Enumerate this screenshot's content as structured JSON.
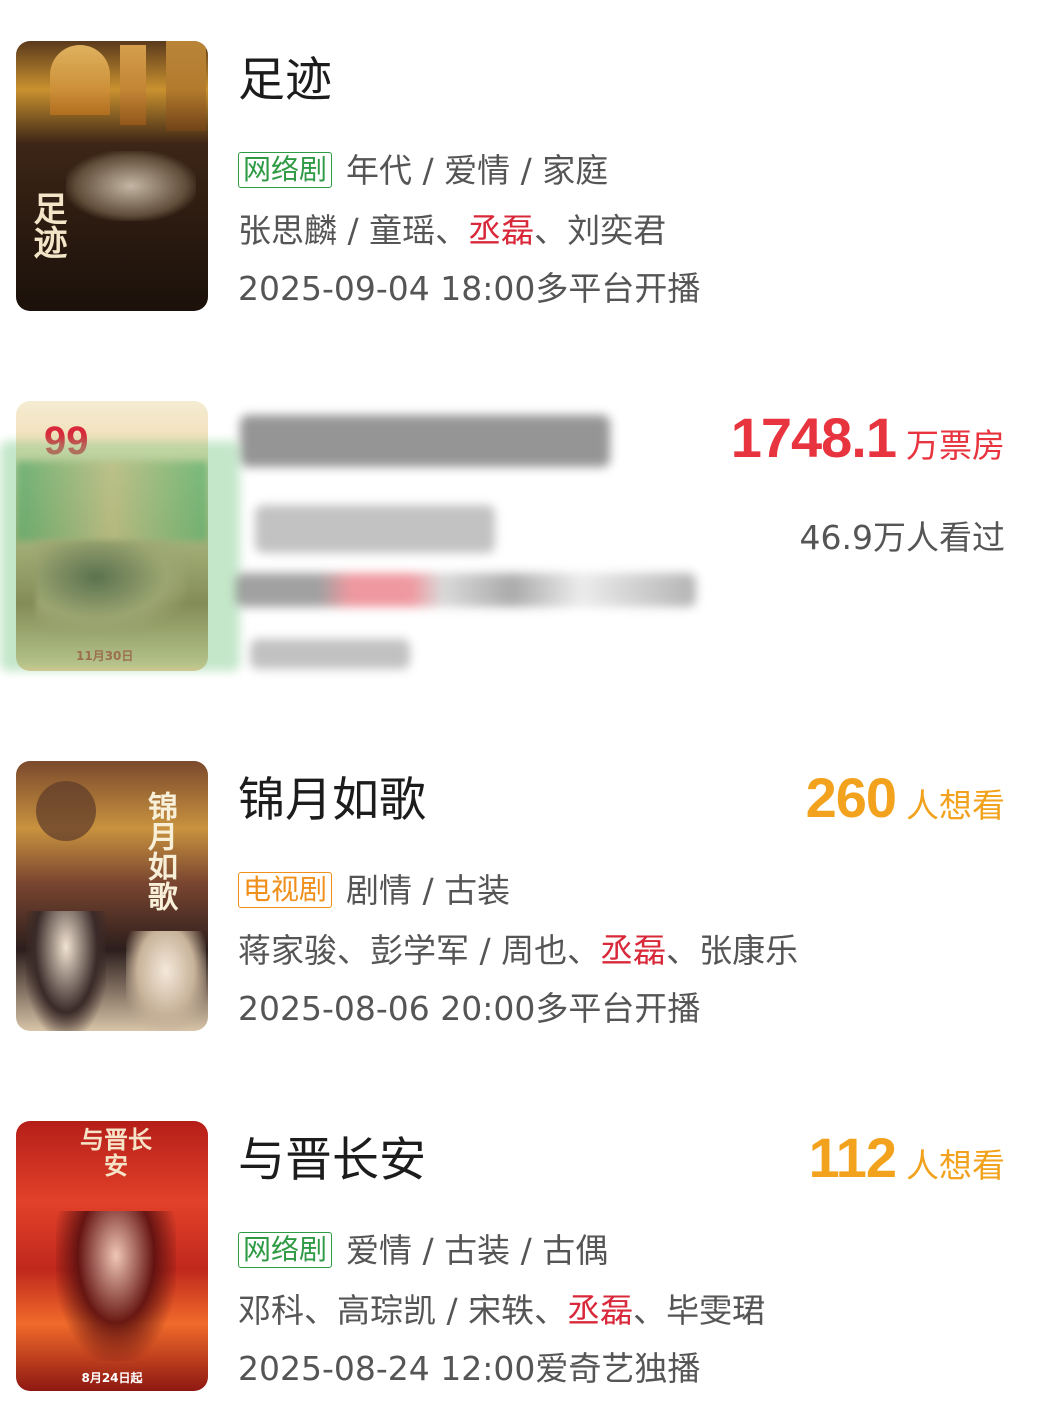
{
  "items": [
    {
      "title": "足迹",
      "poster_text": "足迹",
      "badge": "网络剧",
      "badge_color": "#2f9a44",
      "genres": "年代 / 爱情 / 家庭",
      "crew_pre": "张思麟 / 童瑶、",
      "crew_highlight": "丞磊",
      "crew_post": "、刘奕君",
      "release": "2025-09-04 18:00多平台开播"
    },
    {
      "title": "",
      "poster_text": "99",
      "poster_date": "11月30日",
      "box_office": "1748.1",
      "box_office_unit": "万票房",
      "viewers": "46.9万人看过",
      "accent": "#e8343f"
    },
    {
      "title": "锦月如歌",
      "poster_text": "锦月如歌",
      "want_count": "260",
      "want_unit": "人想看",
      "badge": "电视剧",
      "badge_color": "#f0901c",
      "genres": "剧情 / 古装",
      "crew_pre": "蒋家骏、彭学军 / 周也、",
      "crew_highlight": "丞磊",
      "crew_post": "、张康乐",
      "release": "2025-08-06 20:00多平台开播"
    },
    {
      "title": "与晋长安",
      "poster_text": "与晋长安",
      "poster_date": "8月24日起",
      "want_count": "112",
      "want_unit": "人想看",
      "badge": "网络剧",
      "badge_color": "#2f9a44",
      "genres": "爱情 / 古装 / 古偶",
      "crew_pre": "邓科、高琮凯 / 宋轶、",
      "crew_highlight": "丞磊",
      "crew_post": "、毕雯珺",
      "release": "2025-08-24 12:00爱奇艺独播"
    }
  ]
}
